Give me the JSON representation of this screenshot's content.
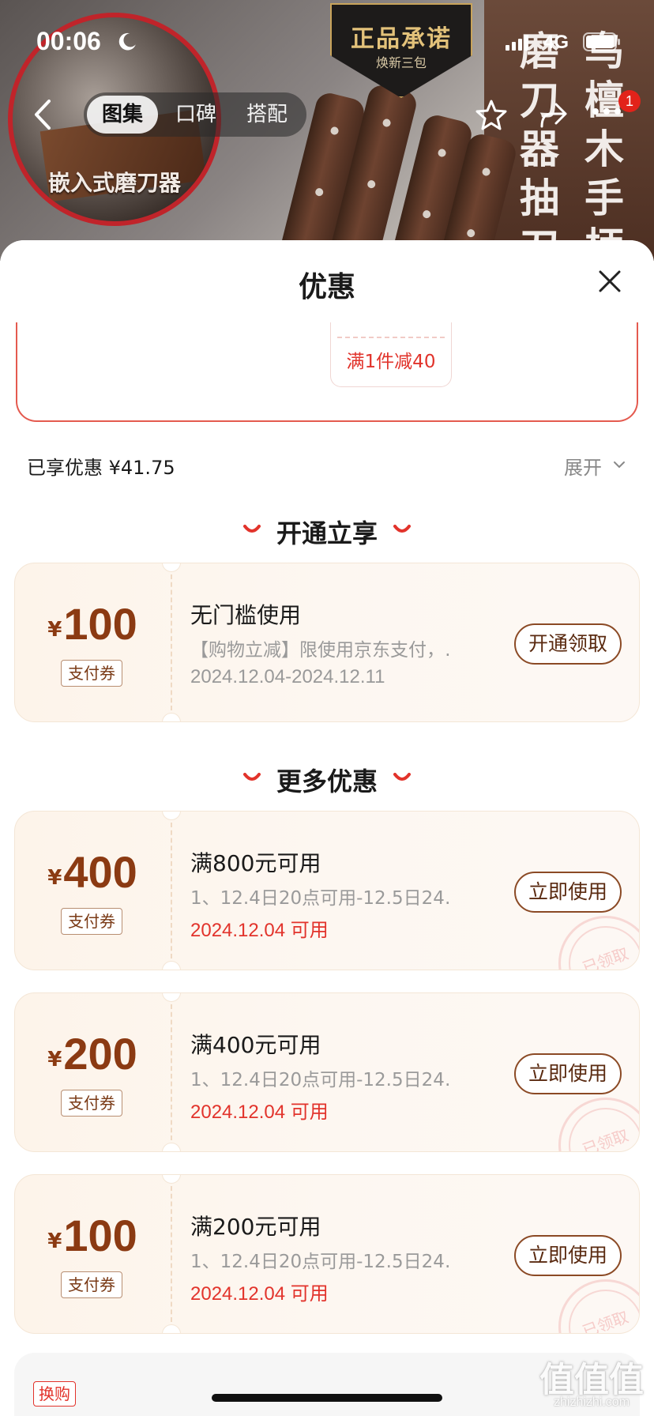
{
  "status_bar": {
    "time": "00:06",
    "network": "4G",
    "icons": [
      "moon-icon",
      "signal-icon",
      "battery-icon"
    ]
  },
  "hero": {
    "circle_label": "嵌入式磨刀器",
    "badge_title": "正品承诺",
    "badge_subtitle": "焕新三包",
    "vertical_text_1": "磨刀器抽刀",
    "vertical_text_2": "乌檀木手柄"
  },
  "nav": {
    "tabs": [
      {
        "label": "图集",
        "active": true
      },
      {
        "label": "口碑",
        "active": false
      },
      {
        "label": "搭配",
        "active": false
      }
    ],
    "message_badge": "1",
    "icons": [
      "back-icon",
      "star-icon",
      "share-icon",
      "more-icon"
    ]
  },
  "sheet": {
    "title": "优惠",
    "previous_offer_pill": "满1件减40",
    "enjoyed_label": "已享优惠 ¥41.75",
    "expand_label": "展开",
    "sections": [
      {
        "heading": "开通立享",
        "coupons": [
          {
            "currency": "¥",
            "amount": "100",
            "tag": "支付券",
            "title": "无门槛使用",
            "desc": "【购物立减】限使用京东支付，…",
            "date": "2024.12.04-2024.12.11",
            "button": "开通领取"
          }
        ]
      },
      {
        "heading": "更多优惠",
        "coupons": [
          {
            "currency": "¥",
            "amount": "400",
            "tag": "支付券",
            "title": "满800元可用",
            "desc": "1、12.4日20点可用-12.5日24…",
            "date": "2024.12.04 可用",
            "button": "立即使用",
            "stamp": "已领取"
          },
          {
            "currency": "¥",
            "amount": "200",
            "tag": "支付券",
            "title": "满400元可用",
            "desc": "1、12.4日20点可用-12.5日24…",
            "date": "2024.12.04 可用",
            "button": "立即使用",
            "stamp": "已领取"
          },
          {
            "currency": "¥",
            "amount": "100",
            "tag": "支付券",
            "title": "满200元可用",
            "desc": "1、12.4日20点可用-12.5日24…",
            "date": "2024.12.04 可用",
            "button": "立即使用",
            "stamp": "已领取"
          }
        ]
      }
    ],
    "bottom_tag": "换购"
  },
  "watermark": {
    "logo": "值值值",
    "site": "zhizhizhi.com"
  },
  "colors": {
    "accent_red": "#e2332b",
    "coupon_brown": "#8b3a12",
    "coupon_bg": "#fdf4ea"
  }
}
